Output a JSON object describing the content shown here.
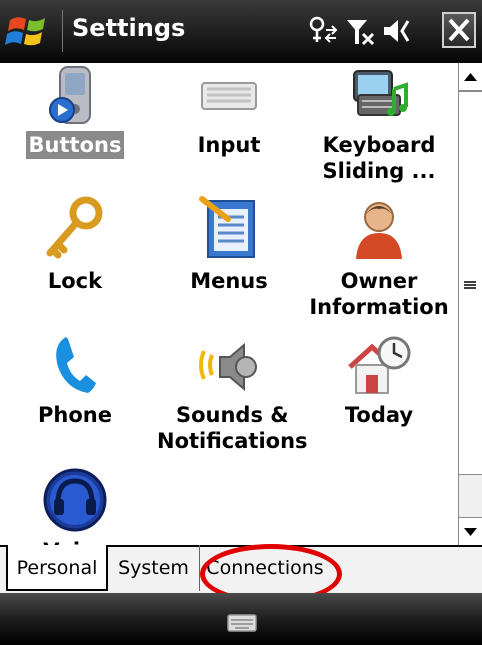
{
  "titlebar": {
    "title": "Settings",
    "icons": [
      "start-flag-icon",
      "connectivity-icon",
      "signal-off-icon",
      "volume-off-icon",
      "close-icon"
    ]
  },
  "tiles": [
    {
      "label": "Buttons",
      "icon": "buttons-icon",
      "selected": true
    },
    {
      "label": "Input",
      "icon": "keyboard-icon"
    },
    {
      "label": "Keyboard Sliding ...",
      "icon": "keyboard-sliding-icon"
    },
    {
      "label": "Lock",
      "icon": "key-icon"
    },
    {
      "label": "Menus",
      "icon": "menus-icon"
    },
    {
      "label": "Owner Information",
      "icon": "owner-icon"
    },
    {
      "label": "Phone",
      "icon": "phone-icon"
    },
    {
      "label": "Sounds & Notifications",
      "icon": "speaker-icon"
    },
    {
      "label": "Today",
      "icon": "today-house-clock-icon"
    },
    {
      "label": "Voice",
      "icon": "headset-icon"
    }
  ],
  "tabs": [
    {
      "label": "Personal",
      "active": true
    },
    {
      "label": "System"
    },
    {
      "label": "Connections"
    }
  ],
  "colors": {
    "highlight_ring": "#e00000",
    "selected_label_bg": "#8a8a8a",
    "titlebar": "#1d1d1d"
  }
}
